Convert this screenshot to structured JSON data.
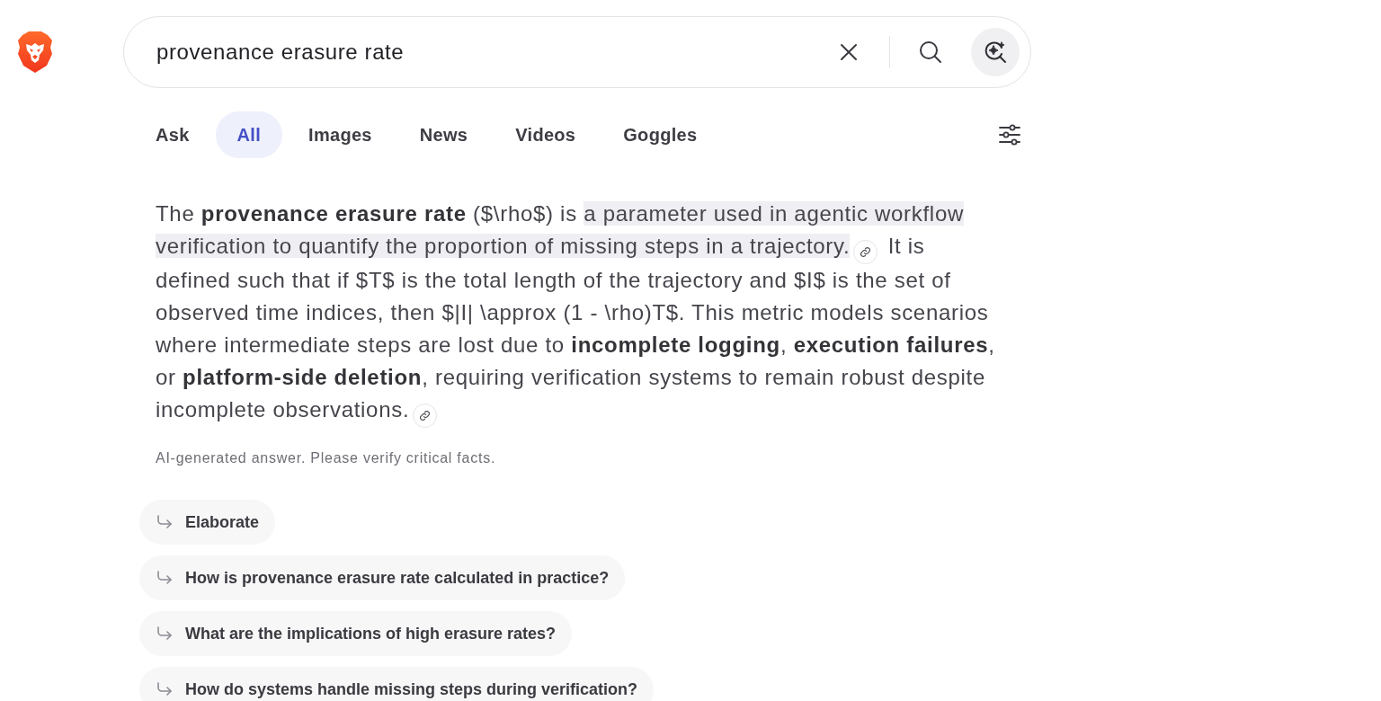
{
  "search": {
    "value": "provenance erasure rate"
  },
  "tabs": [
    {
      "label": "Ask",
      "selected": false
    },
    {
      "label": "All",
      "selected": true
    },
    {
      "label": "Images",
      "selected": false
    },
    {
      "label": "News",
      "selected": false
    },
    {
      "label": "Videos",
      "selected": false
    },
    {
      "label": "Goggles",
      "selected": false
    }
  ],
  "answer": {
    "sentences": [
      {
        "parts": [
          {
            "text": "The **provenance erasure rate** ($\\rho$) is ",
            "highlighted": false
          },
          {
            "text": "a parameter used in agentic workflow verification to quantify the proportion of missing steps in a trajectory.",
            "highlighted": true
          }
        ],
        "citation": true
      },
      {
        "parts": [
          {
            "text": "It is defined such that if $T$ is the total length of the trajectory and $I$ is the set of observed time indices, then $|I| \\approx (1 - \\rho)T$. This metric models scenarios where intermediate steps are lost due to **incomplete logging**, **execution failures**, or **platform-side deletion**, requiring verification systems to remain robust despite incomplete observations.",
            "highlighted": false
          }
        ],
        "citation": true
      }
    ],
    "disclaimer": "AI-generated answer. Please verify critical facts."
  },
  "follow_ups": [
    "Elaborate",
    "How is provenance erasure rate calculated in practice?",
    "What are the implications of high erasure rates?",
    "How do systems handle missing steps during verification?"
  ]
}
